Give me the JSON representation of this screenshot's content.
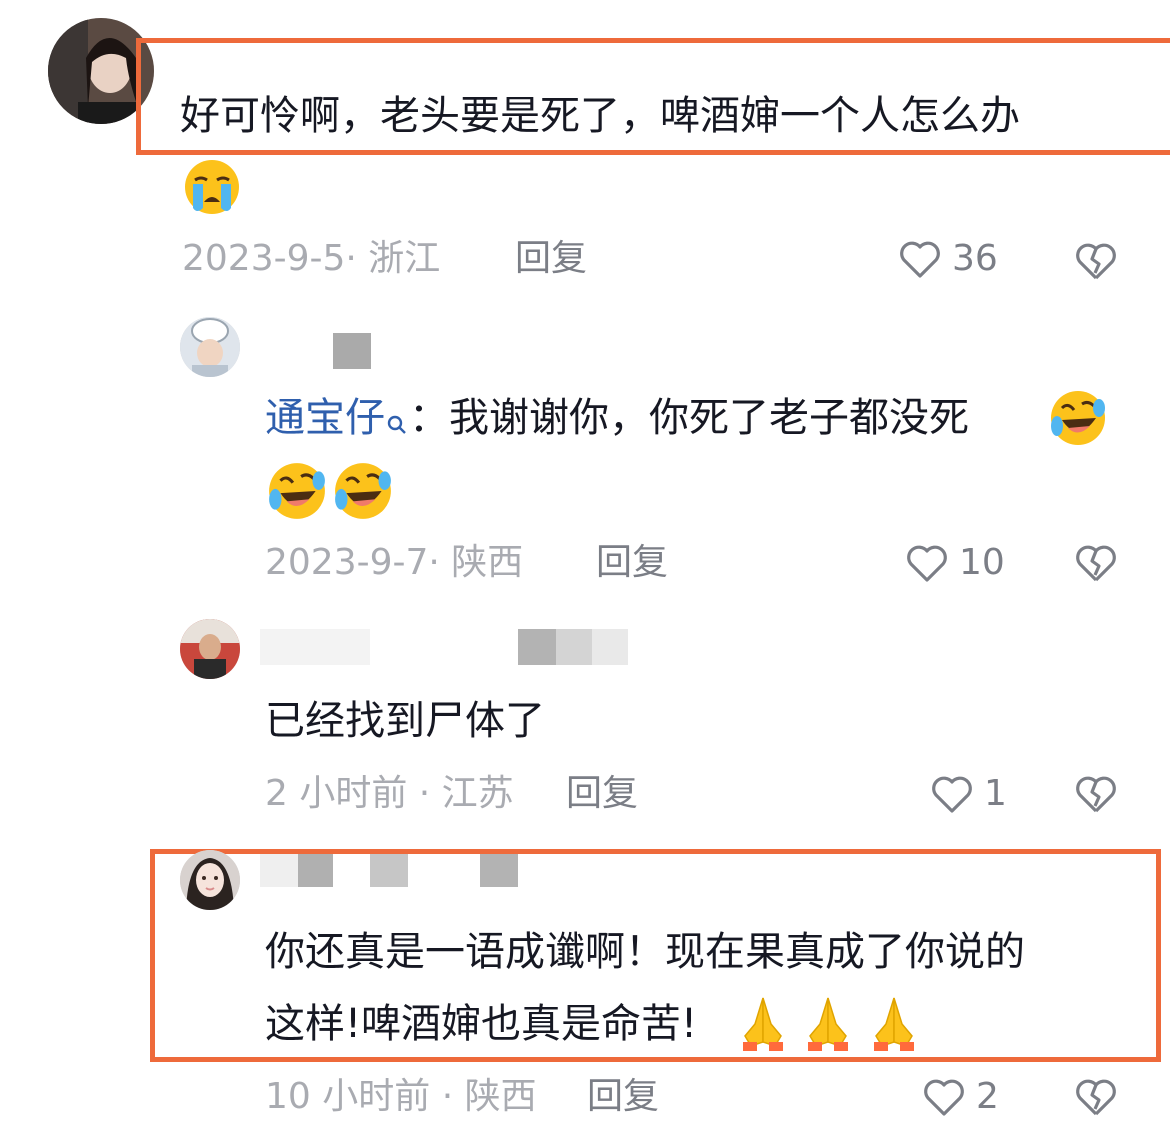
{
  "colors": {
    "highlight_border": "#ee6a3b",
    "username": "#2f5fad",
    "meta": "#a9abb1",
    "text": "#161823"
  },
  "comments": [
    {
      "text": "好可怜啊，老头要是死了，啤酒婶一个人怎么办",
      "emojis": [
        "crying-face"
      ],
      "date": "2023-9-5· 浙江",
      "reply_label": "回复",
      "likes": "36"
    },
    {
      "username": "通宝仔",
      "username_icon": "search-icon",
      "separator": "：",
      "text": "我谢谢你，你死了老子都没死",
      "emojis": [
        "rolling-laughing",
        "rolling-laughing",
        "rolling-laughing"
      ],
      "date": "2023-9-7· 陕西",
      "reply_label": "回复",
      "likes": "10"
    },
    {
      "text": "已经找到尸体了",
      "date": "2 小时前 · 江苏",
      "reply_label": "回复",
      "likes": "1"
    },
    {
      "text_line1": "你还真是一语成谶啊！现在果真成了你说的",
      "text_line2": "这样!啤酒婶也真是命苦!",
      "emojis": [
        "folded-hands",
        "folded-hands",
        "folded-hands"
      ],
      "date": "10 小时前 · 陕西",
      "reply_label": "回复",
      "likes": "2"
    }
  ]
}
